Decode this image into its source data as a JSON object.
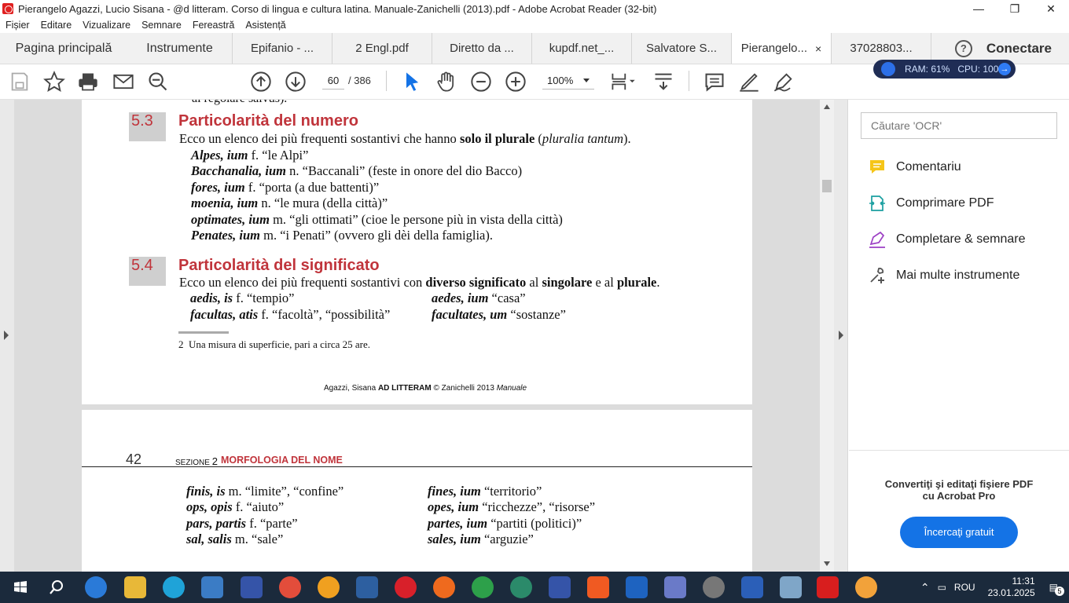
{
  "window": {
    "title": "Pierangelo Agazzi, Lucio Sisana - @d litteram. Corso di lingua e cultura latina. Manuale-Zanichelli (2013).pdf - Adobe Acrobat Reader (32-bit)",
    "min": "—",
    "max": "❐",
    "close": "✕"
  },
  "menu": [
    "Fișier",
    "Editare",
    "Vizualizare",
    "Semnare",
    "Fereastră",
    "Asistență"
  ],
  "tabs": [
    {
      "label": "Pagina principală"
    },
    {
      "label": "Instrumente"
    },
    {
      "label": "Epifanio - ..."
    },
    {
      "label": "2 Engl.pdf"
    },
    {
      "label": "Diretto da ..."
    },
    {
      "label": "kupdf.net_..."
    },
    {
      "label": "Salvatore S..."
    },
    {
      "label": "Pierangelo...",
      "close": "×"
    },
    {
      "label": "37028803..."
    }
  ],
  "tabbar_right": {
    "help": "?",
    "signin": "Conectare"
  },
  "toolbar": {
    "page_current": "60",
    "page_total": "/ 386",
    "zoom": "100%"
  },
  "monitor": {
    "ram": "RAM: 61%",
    "cpu": "CPU: 100%"
  },
  "page1": {
    "cut_top": "al regolare salvus).",
    "sec53_num": "5.3",
    "sec53_title": "Particolarità del numero",
    "sec53_intro_a": "Ecco un elenco dei più frequenti sostantivi che hanno ",
    "sec53_intro_b": "solo il plurale",
    "sec53_intro_c": " (",
    "sec53_intro_d": "pluralia tantum",
    "sec53_intro_e": ").",
    "entries53": [
      {
        "term": "Alpes, ium",
        "rest": " f. “le Alpi”"
      },
      {
        "term": "Bacchanalia, ium",
        "rest": " n. “Baccanali” (feste in onore del dio Bacco)"
      },
      {
        "term": "fores, ium",
        "rest": " f. “porta (a due battenti)”"
      },
      {
        "term": "moenia, ium",
        "rest": " n. “le mura (della città)”"
      },
      {
        "term": "optimates, ium",
        "rest": " m. “gli ottimati” (cioe le persone più in vista della città)"
      },
      {
        "term": "Penates, ium",
        "rest": " m. “i Penati” (ovvero gli dèi della famiglia)."
      }
    ],
    "sec54_num": "5.4",
    "sec54_title": "Particolarità del significato",
    "sec54_intro_a": "Ecco un elenco dei più frequenti sostantivi con ",
    "sec54_intro_b": "diverso significato",
    "sec54_intro_c": " al ",
    "sec54_intro_d": "singolare",
    "sec54_intro_e": " e al ",
    "sec54_intro_f": "plurale",
    "sec54_intro_g": ".",
    "pairs54": [
      {
        "s_term": "aedis, is",
        "s_rest": " f. “tempio”",
        "p_term": "aedes, ium",
        "p_rest": " “casa”"
      },
      {
        "s_term": "facultas, atis",
        "s_rest": " f. “facoltà”, “possibilità”",
        "p_term": "facultates, um",
        "p_rest": " “sostanze”"
      }
    ],
    "footnote_num": "2",
    "footnote": "Una misura di superficie, pari a circa 25 are.",
    "footer_a": "Agazzi, Sisana ",
    "footer_b": "AD LITTERAM",
    "footer_c": " © Zanichelli 2013 ",
    "footer_d": "Manuale"
  },
  "page2": {
    "page_number": "42",
    "section_label": "SEZIONE",
    "section_num": "2",
    "section_title": "MORFOLOGIA DEL NOME",
    "pairs": [
      {
        "s_term": "finis, is",
        "s_rest": " m. “limite”, “confine”",
        "p_term": "fines, ium",
        "p_rest": " “territorio”"
      },
      {
        "s_term": "ops, opis",
        "s_rest": " f. “aiuto”",
        "p_term": "opes, ium",
        "p_rest": " “ricchezze”, “risorse”"
      },
      {
        "s_term": "pars, partis",
        "s_rest": " f. “parte”",
        "p_term": "partes, ium",
        "p_rest": " “partiti (politici)”"
      },
      {
        "s_term": "sal, salis",
        "s_rest": " m. “sale”",
        "p_term": "sales, ium",
        "p_rest": " “arguzie”"
      }
    ]
  },
  "panel": {
    "search_placeholder": "Căutare 'OCR'",
    "tools": [
      "Comentariu",
      "Comprimare PDF",
      "Completare & semnare",
      "Mai multe instrumente"
    ],
    "promo_line1": "Convertiţi şi editaţi fişiere PDF",
    "promo_line2": "cu Acrobat Pro",
    "promo_button": "Încercaţi gratuit"
  },
  "taskbar": {
    "lang": "ROU",
    "time": "11:31",
    "date": "23.01.2025",
    "notif_count": "5"
  },
  "colors": {
    "accent": "#1473e6",
    "heading": "#c0343b",
    "taskbar": "#1b2a3c"
  }
}
